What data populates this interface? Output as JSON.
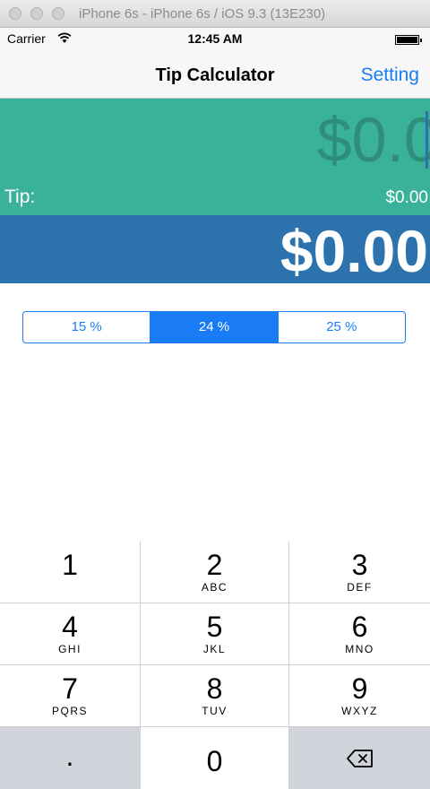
{
  "window": {
    "title": "iPhone 6s - iPhone 6s / iOS 9.3 (13E230)"
  },
  "status": {
    "carrier": "Carrier",
    "time": "12:45 AM"
  },
  "nav": {
    "title": "Tip Calculator",
    "setting": "Setting"
  },
  "bill": {
    "amount": "$0.0",
    "tip_label": "Tip:",
    "tip_value": "$0.00"
  },
  "total": {
    "amount": "$0.00"
  },
  "segments": [
    "15 %",
    "24 %",
    "25 %"
  ],
  "selected_segment": "24 %",
  "keypad": {
    "keys": [
      {
        "num": "1",
        "letters": ""
      },
      {
        "num": "2",
        "letters": "ABC"
      },
      {
        "num": "3",
        "letters": "DEF"
      },
      {
        "num": "4",
        "letters": "GHI"
      },
      {
        "num": "5",
        "letters": "JKL"
      },
      {
        "num": "6",
        "letters": "MNO"
      },
      {
        "num": "7",
        "letters": "PQRS"
      },
      {
        "num": "8",
        "letters": "TUV"
      },
      {
        "num": "9",
        "letters": "WXYZ"
      },
      {
        "num": ".",
        "letters": ""
      },
      {
        "num": "0",
        "letters": ""
      },
      {
        "num": "",
        "letters": ""
      }
    ],
    "delete_icon": "backspace-icon"
  },
  "colors": {
    "bill_bg": "#3ab29a",
    "total_bg": "#2c73ad",
    "accent": "#1a7cf5"
  }
}
